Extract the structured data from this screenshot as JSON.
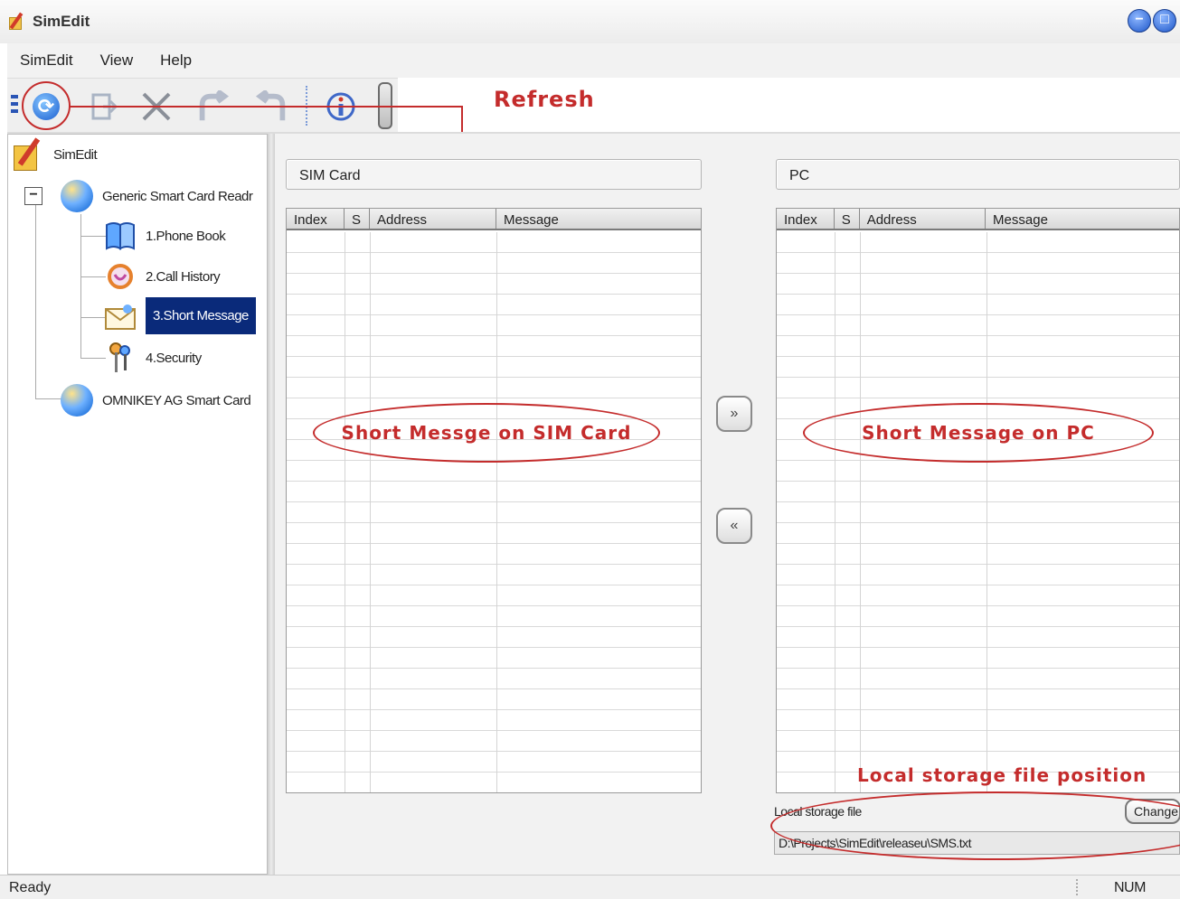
{
  "window": {
    "title": "SimEdit",
    "min_glyph": "−",
    "max_glyph": "□"
  },
  "menu": {
    "items": [
      "SimEdit",
      "View",
      "Help"
    ]
  },
  "toolbar": {
    "icons": [
      "refresh-icon",
      "exit-icon",
      "delete-icon",
      "undo-icon",
      "redo-icon",
      "info-icon"
    ]
  },
  "annotations": {
    "refresh": "Refresh",
    "sim_area": "Short Messge on SIM Card",
    "pc_area": "Short Message on PC",
    "storage": "Local storage file position"
  },
  "tree": {
    "root": "SimEdit",
    "reader1": "Generic Smart Card Readr",
    "items": [
      "1.Phone Book",
      "2.Call History",
      "3.Short Message",
      "4.Security"
    ],
    "selected": "3.Short Message",
    "reader2": "OMNIKEY AG Smart Card",
    "expander": "−"
  },
  "sim_panel": {
    "title": "SIM Card",
    "columns": [
      "Index",
      "S",
      "Address",
      "Message"
    ]
  },
  "pc_panel": {
    "title": "PC",
    "columns": [
      "Index",
      "S",
      "Address",
      "Message"
    ]
  },
  "transfer": {
    "to_pc": "»",
    "to_sim": "«"
  },
  "storage": {
    "label": "Local storage file",
    "change_button": "Change",
    "path": "D:\\Projects\\SimEdit\\releaseu\\SMS.txt"
  },
  "status": {
    "text": "Ready",
    "num": "NUM"
  }
}
